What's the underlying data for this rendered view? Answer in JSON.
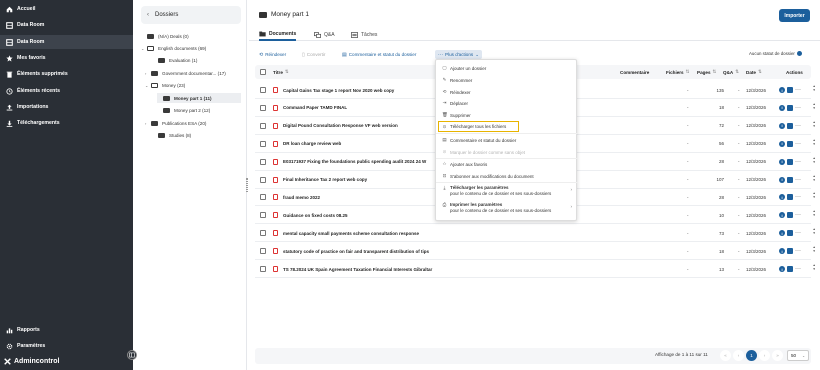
{
  "nav": {
    "items": [
      {
        "label": "Accueil",
        "icon": "home-icon"
      },
      {
        "label": "Data Room",
        "icon": "grid-icon"
      },
      {
        "label": "Data Room",
        "icon": "grid-icon"
      },
      {
        "label": "Mes favoris",
        "icon": "star-icon"
      },
      {
        "label": "Éléments supprimés",
        "icon": "trash-icon"
      },
      {
        "label": "Éléments récents",
        "icon": "history-icon"
      },
      {
        "label": "Importations",
        "icon": "upload-icon"
      },
      {
        "label": "Téléchargements",
        "icon": "download-icon"
      }
    ],
    "bottom": [
      {
        "label": "Rapports",
        "icon": "chart-icon"
      },
      {
        "label": "Paramètres",
        "icon": "gear-icon"
      }
    ],
    "brand": "Admincontrol"
  },
  "folders": {
    "title": "Dossiers",
    "tree": [
      {
        "label": "(N/A) Deals (0)"
      },
      {
        "label": "English documents (69)"
      },
      {
        "label": "Evaluation (1)"
      },
      {
        "label": "Government documentar... (17)"
      },
      {
        "label": "Money (23)"
      },
      {
        "label": "Money part 1 (11)"
      },
      {
        "label": "Money part 2 (12)"
      },
      {
        "label": "Publications ESA (20)"
      },
      {
        "label": "Studies (8)"
      }
    ]
  },
  "main": {
    "title": "Money part 1",
    "import_label": "Importer",
    "tabs": [
      {
        "label": "Documents"
      },
      {
        "label": "Q&A"
      },
      {
        "label": "Tâches"
      }
    ],
    "toolbar": {
      "reindex": "Réindexer",
      "convert": "Convertir",
      "comment_status": "Commentaire et statut du dossier",
      "more_actions": "Plus d'actions"
    },
    "no_status": "Aucun statut de dossier",
    "columns": {
      "title": "Titre",
      "comment": "Commentaire",
      "files": "Fichiers",
      "pages": "Pages",
      "qa": "Q&A",
      "date": "Date",
      "actions": "Actions"
    },
    "rows": [
      {
        "title": "Capital Gains Tax stage 1 report Nov 2020 web copy",
        "files": "-",
        "pages": "135",
        "qa": "-",
        "date": "12/3/2026"
      },
      {
        "title": "Command Paper TAMD FINAL",
        "files": "-",
        "pages": "18",
        "qa": "-",
        "date": "12/3/2026"
      },
      {
        "title": "Digital Pound Consultation Response VF web version",
        "files": "-",
        "pages": "72",
        "qa": "-",
        "date": "12/3/2026"
      },
      {
        "title": "DR loan charge review web",
        "files": "-",
        "pages": "56",
        "qa": "-",
        "date": "12/3/2026"
      },
      {
        "title": "E03171937 Fixing the foundations public spending audit 2024 24 W",
        "files": "-",
        "pages": "28",
        "qa": "-",
        "date": "12/3/2026"
      },
      {
        "title": "Final Inheritance Tax 2 report web copy",
        "files": "-",
        "pages": "107",
        "qa": "-",
        "date": "12/3/2026"
      },
      {
        "title": "fraud memo 2022",
        "files": "-",
        "pages": "28",
        "qa": "-",
        "date": "12/3/2026"
      },
      {
        "title": "Guidance on fixed costs 08.25",
        "files": "-",
        "pages": "10",
        "qa": "-",
        "date": "12/3/2026"
      },
      {
        "title": "mental capacity small payments scheme consultation response",
        "files": "-",
        "pages": "73",
        "qa": "-",
        "date": "12/3/2026"
      },
      {
        "title": "statutory code of practice on fair and transparent distribution of tips",
        "files": "-",
        "pages": "18",
        "qa": "-",
        "date": "12/3/2026"
      },
      {
        "title": "TS 78.2024 UK Spain Agreement Taxation Financial Interests Gibraltar",
        "files": "-",
        "pages": "13",
        "qa": "-",
        "date": "12/3/2026"
      }
    ],
    "pagination": {
      "text": "Affichage de 1 à 11 sur 11",
      "current": "1",
      "per_page": "50"
    }
  },
  "dropdown": {
    "items": [
      {
        "label": "Ajouter un dossier",
        "icon": "folder-plus-icon"
      },
      {
        "label": "Renommer",
        "icon": "pencil-icon"
      },
      {
        "label": "Réindexer",
        "icon": "reindex-icon"
      },
      {
        "label": "Déplacer",
        "icon": "move-icon"
      },
      {
        "label": "Supprimer",
        "icon": "trash-icon"
      },
      {
        "label": "Télécharger tous les fichiers",
        "icon": "download-icon"
      },
      {
        "label": "Commentaire et statut du dossier",
        "icon": "comment-icon"
      },
      {
        "label": "Marquer le dossier comme sans objet",
        "icon": "na-icon"
      },
      {
        "label": "Ajouter aux favoris",
        "icon": "star-icon"
      },
      {
        "label": "S'abonner aux modifications du document",
        "icon": "subscribe-icon"
      },
      {
        "label": "Télécharger les paramètres",
        "sub": "pour le contenu de ce dossier et ses sous-dossiers",
        "icon": "download-icon"
      },
      {
        "label": "Imprimer les paramètres",
        "sub": "pour le contenu de ce dossier et ses sous-dossiers",
        "icon": "print-icon"
      }
    ]
  },
  "colors": {
    "sidebar_bg": "#2a2f36",
    "accent": "#1c5f9c",
    "highlight_border": "#e8b400",
    "pdf_red": "#d33"
  }
}
